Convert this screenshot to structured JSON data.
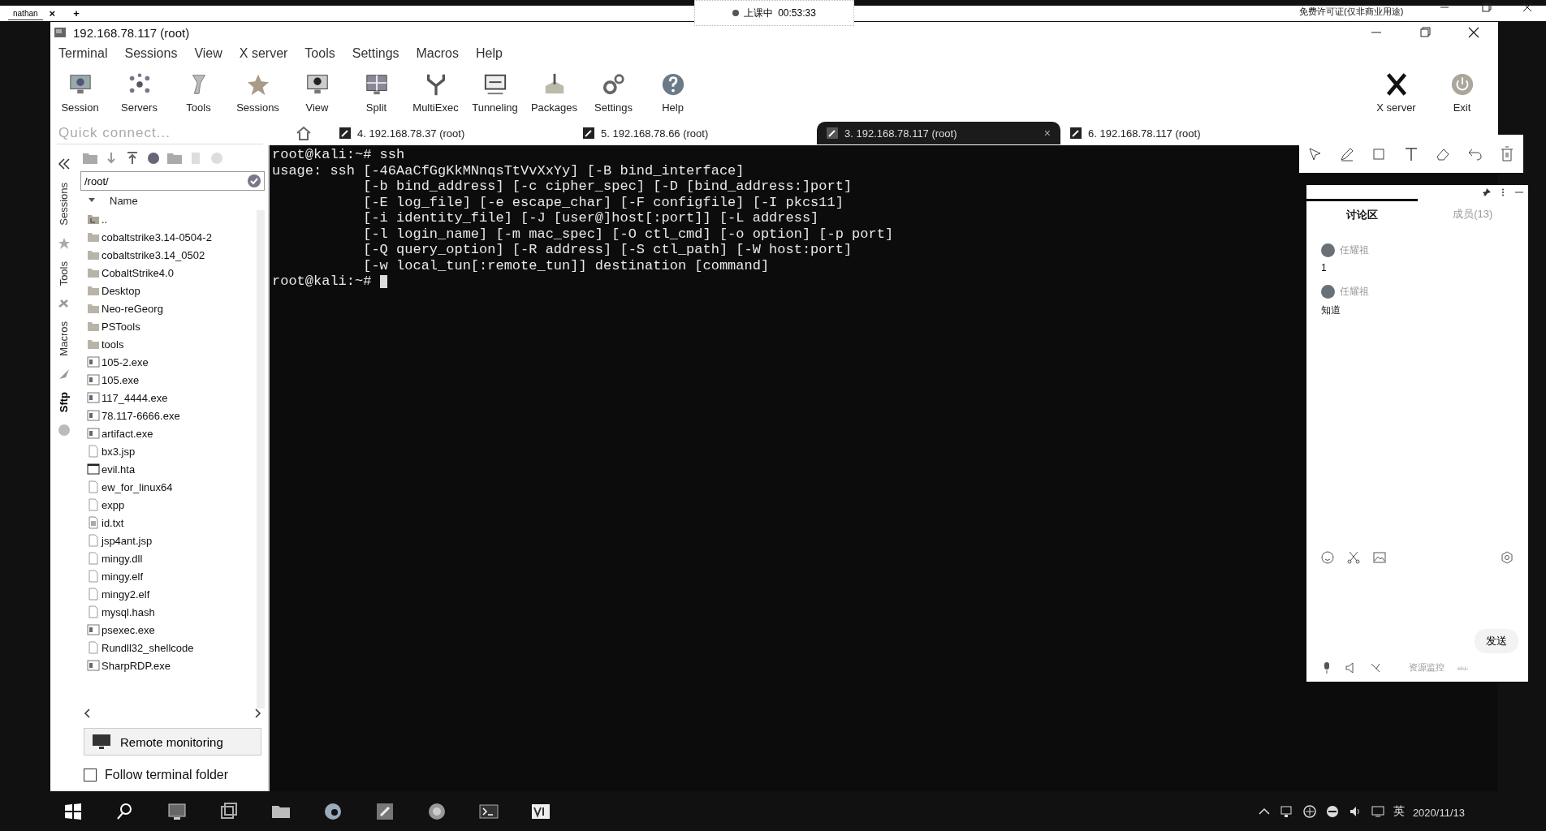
{
  "browser_tabs": [
    {
      "label": "nathan",
      "selected": true
    }
  ],
  "new_tab": "+",
  "close_tab": "×",
  "class_status": {
    "label": "上课中",
    "time": "00:53:33"
  },
  "license_note": "免费许可证(仅非商业用途)",
  "window": {
    "title": "192.168.78.117 (root)"
  },
  "menu": [
    "Terminal",
    "Sessions",
    "View",
    "X server",
    "Tools",
    "Settings",
    "Macros",
    "Help"
  ],
  "toolbar": [
    "Session",
    "Servers",
    "Tools",
    "Sessions",
    "View",
    "Split",
    "MultiExec",
    "Tunneling",
    "Packages",
    "Settings",
    "Help"
  ],
  "toolbar_right": [
    "X server",
    "Exit"
  ],
  "quick_connect": {
    "placeholder": "Quick connect..."
  },
  "session_tabs": [
    {
      "label": "4. 192.168.78.37 (root)",
      "selected": false
    },
    {
      "label": "5. 192.168.78.66 (root)",
      "selected": false
    },
    {
      "label": "3. 192.168.78.117 (root)",
      "selected": true
    },
    {
      "label": "6. 192.168.78.117 (root)",
      "selected": false
    }
  ],
  "side_tabs": [
    {
      "label": "Sessions",
      "selected": false
    },
    {
      "label": "Tools",
      "selected": false
    },
    {
      "label": "Macros",
      "selected": false
    },
    {
      "label": "Sftp",
      "selected": true
    }
  ],
  "sftp": {
    "path": "/root/",
    "column": "Name",
    "files": [
      {
        "name": "..",
        "kind": "up"
      },
      {
        "name": "cobaltstrike3.14-0504-2",
        "kind": "folder"
      },
      {
        "name": "cobaltstrike3.14_0502",
        "kind": "folder"
      },
      {
        "name": "CobaltStrike4.0",
        "kind": "folder"
      },
      {
        "name": "Desktop",
        "kind": "folder"
      },
      {
        "name": "Neo-reGeorg",
        "kind": "folder"
      },
      {
        "name": "PSTools",
        "kind": "folder"
      },
      {
        "name": "tools",
        "kind": "folder"
      },
      {
        "name": "105-2.exe",
        "kind": "exe"
      },
      {
        "name": "105.exe",
        "kind": "exe"
      },
      {
        "name": "117_4444.exe",
        "kind": "exe"
      },
      {
        "name": "78.117-6666.exe",
        "kind": "exe"
      },
      {
        "name": "artifact.exe",
        "kind": "exe"
      },
      {
        "name": "bx3.jsp",
        "kind": "file"
      },
      {
        "name": "evil.hta",
        "kind": "window"
      },
      {
        "name": "ew_for_linux64",
        "kind": "file"
      },
      {
        "name": "expp",
        "kind": "file"
      },
      {
        "name": "id.txt",
        "kind": "text"
      },
      {
        "name": "jsp4ant.jsp",
        "kind": "file"
      },
      {
        "name": "mingy.dll",
        "kind": "file"
      },
      {
        "name": "mingy.elf",
        "kind": "file"
      },
      {
        "name": "mingy2.elf",
        "kind": "file"
      },
      {
        "name": "mysql.hash",
        "kind": "file"
      },
      {
        "name": "psexec.exe",
        "kind": "exe"
      },
      {
        "name": "Rundll32_shellcode",
        "kind": "file"
      },
      {
        "name": "SharpRDP.exe",
        "kind": "exe"
      }
    ],
    "remote_monitoring": "Remote monitoring",
    "follow_terminal": {
      "label": "Follow terminal folder",
      "checked": false
    }
  },
  "terminal": {
    "lines": [
      "root@kali:~# ssh",
      "usage: ssh [-46AaCfGgKkMNnqsTtVvXxYy] [-B bind_interface]",
      "           [-b bind_address] [-c cipher_spec] [-D [bind_address:]port]",
      "           [-E log_file] [-e escape_char] [-F configfile] [-I pkcs11]",
      "           [-i identity_file] [-J [user@]host[:port]] [-L address]",
      "           [-l login_name] [-m mac_spec] [-O ctl_cmd] [-o option] [-p port]",
      "           [-Q query_option] [-R address] [-S ctl_path] [-W host:port]",
      "           [-w local_tun[:remote_tun]] destination [command]",
      "root@kali:~# "
    ],
    "cursor": true
  },
  "chat": {
    "tabs": [
      {
        "label": "讨论区",
        "selected": true
      },
      {
        "label": "成员(13)",
        "selected": false
      }
    ],
    "messages": [
      {
        "author": "任耀祖",
        "text": "1"
      },
      {
        "author": "任耀祖",
        "text": "知道"
      }
    ],
    "send": "发送",
    "monitor": "资源监控"
  },
  "tray": {
    "ime": "英",
    "date": "2020/11/13"
  }
}
